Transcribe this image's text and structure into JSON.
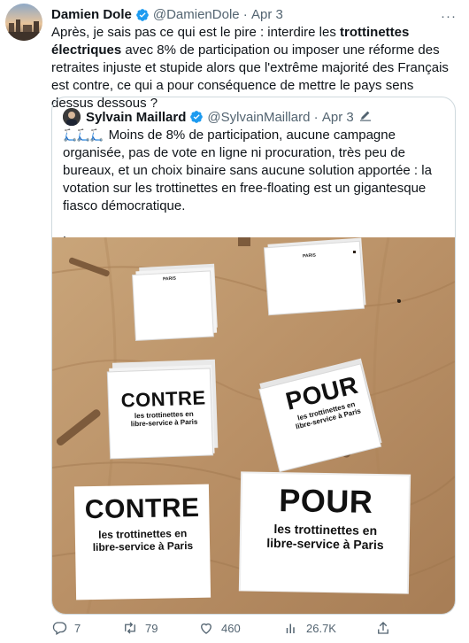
{
  "tweet": {
    "author_name": "Damien Dole",
    "handle": "@DamienDole",
    "date": "Apr 3",
    "more_label": "···",
    "text_before": "Après, je sais pas ce qui est le pire : interdire les ",
    "text_bold": "trottinettes électriques",
    "text_after": " avec 8% de participation ou imposer une réforme des retraites injuste et stupide alors que l'extrême majorité des Français est contre, ce qui a pour conséquence de mettre le pays sens dessus dessous ?"
  },
  "quote": {
    "author_name": "Sylvain Maillard",
    "handle": "@SylvainMaillard",
    "date": "Apr 3",
    "scooter_emojis": "🛴🛴🛴",
    "text": "Moins de 8% de participation, aucune campagne organisée, pas de vote en ligne ni procuration, très peu de bureaux, et un choix binaire sans aucune solution apportée : la votation sur les trottinettes en free-floating est un gigantesque fiasco démocratique.",
    "more": "Les...",
    "photo": {
      "ballot_header": "PARIS",
      "contre": "CONTRE",
      "pour": "POUR",
      "line1": "les trottinettes en",
      "line2": "libre-service à Paris"
    }
  },
  "actions": {
    "replies": "7",
    "retweets": "79",
    "likes": "460",
    "views": "26.7K"
  },
  "colors": {
    "verified": "#1d9bf0",
    "text": "#0f1419",
    "secondary": "#536471",
    "border": "#cfd9de"
  }
}
